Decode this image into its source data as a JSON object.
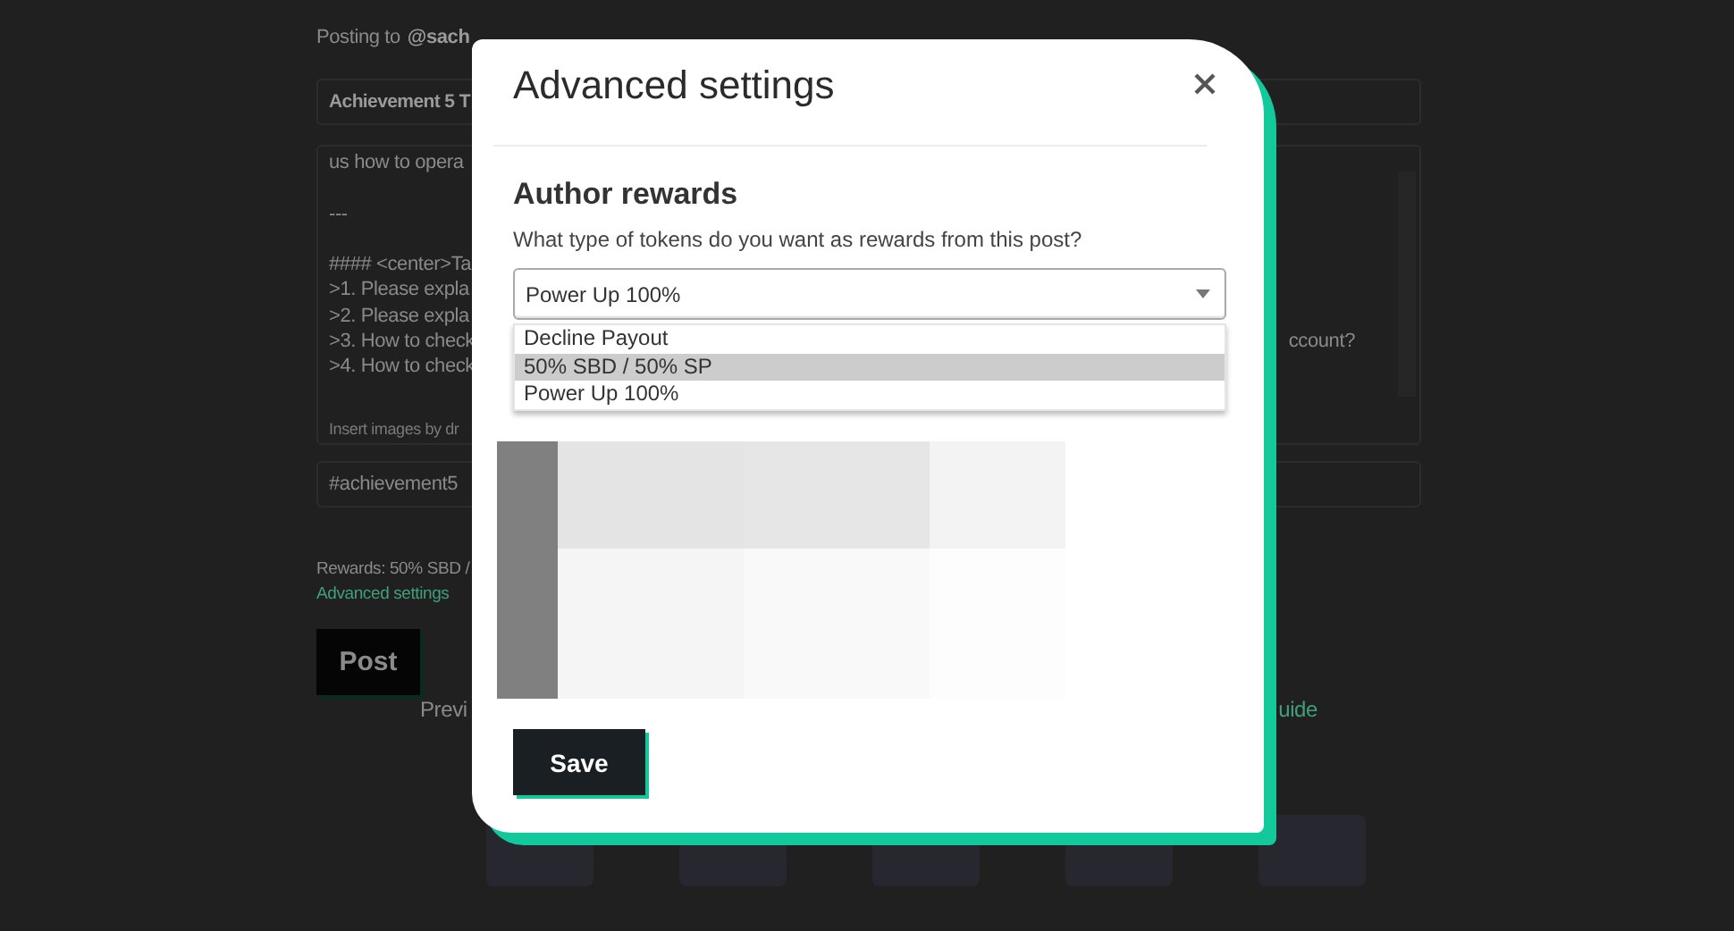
{
  "background_page": {
    "posting_to_label": "Posting to",
    "account": "@sach",
    "title_field": "Achievement 5 T",
    "body_lines": [
      {
        "left": "us how to opera"
      },
      {
        "kind": "blank"
      },
      {
        "left": "---"
      },
      {
        "kind": "blank"
      },
      {
        "left": "#### <center>Ta"
      },
      {
        "left": ">1. Please expla"
      },
      {
        "left": ">2. Please expla"
      },
      {
        "left": ">3. How to check",
        "right": "ccount?"
      },
      {
        "left": ">4. How to check"
      }
    ],
    "image_hint": "Insert images by dr",
    "tags_field": "#achievement5",
    "rewards": "Rewards: 50% SBD /",
    "advanced_link": "Advanced settings",
    "post_button": "Post",
    "preview_label": "Previ",
    "guide_link": "uide"
  },
  "modal": {
    "title": "Advanced settings",
    "section_title": "Author rewards",
    "question": "What type of tokens do you want as rewards from this post?",
    "select_value": "Power Up 100%",
    "options": [
      {
        "label": "Decline Payout",
        "selected": false
      },
      {
        "label": "50% SBD / 50% SP",
        "selected": true
      },
      {
        "label": "Power Up 100%",
        "selected": false
      }
    ],
    "save_button": "Save"
  }
}
